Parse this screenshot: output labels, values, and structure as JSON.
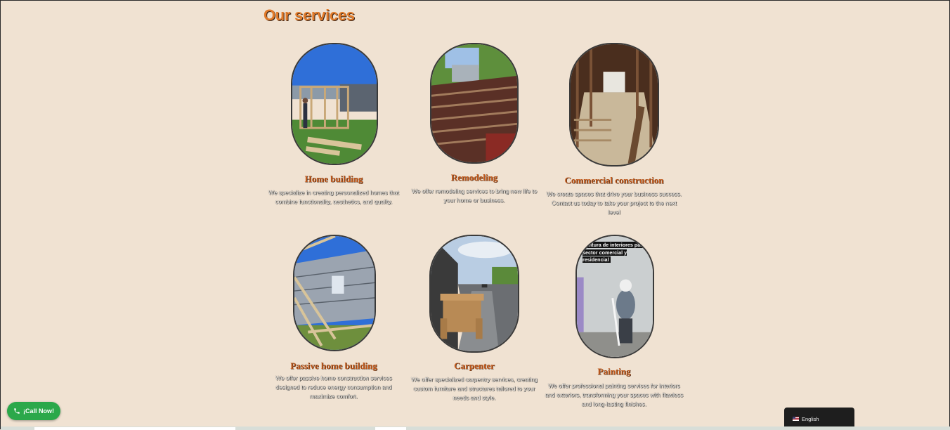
{
  "section_title": "Our services",
  "services": [
    {
      "title": "Home building",
      "description": "We specialize in creating personalized homes that combine functionality, aesthetics, and quality.",
      "image_icon": "photo-home-framing"
    },
    {
      "title": "Remodeling",
      "description": "We offer remodeling services to bring new life to your home or business.",
      "image_icon": "photo-roof-remodel"
    },
    {
      "title": "Commercial construction",
      "description": "We create spaces that drive your business success. Contact us today to take your project to the next level",
      "image_icon": "photo-interior-framing"
    },
    {
      "title": "Passive home building",
      "description": "We offer passive home construction services designed to reduce energy consumption and maximize comfort.",
      "image_icon": "photo-passive-home"
    },
    {
      "title": "Carpenter",
      "description": "We offer specialized carpentry services, creating custom furniture and structures tailored to your needs and style.",
      "image_icon": "photo-wood-bench"
    },
    {
      "title": "Painting",
      "description": "We offer professional painting services for interiors and exteriors, transforming your spaces with flawless and long-lasting finishes.",
      "image_icon": "photo-painter",
      "overlay_text": "Pintura de interiores para sector comercial y residencial"
    }
  ],
  "call_button": {
    "label": "¡Call Now!",
    "icon": "phone-icon",
    "color": "#2ba84a"
  },
  "language_switcher": {
    "label": "English",
    "icon": "us-flag-icon"
  },
  "colors": {
    "background": "#f0e2d2",
    "accent": "#e07a2a",
    "title_accent": "#c25a1c"
  }
}
